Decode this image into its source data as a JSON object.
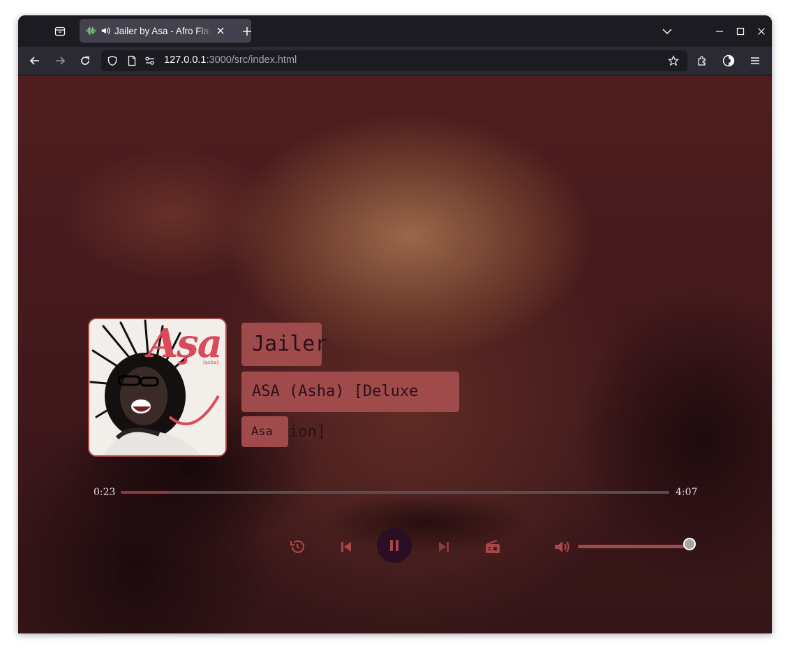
{
  "browser": {
    "tab_title": "Jailer by Asa - Afro Flav",
    "url_host": "127.0.0.1",
    "url_rest": ":3000/src/index.html"
  },
  "player": {
    "song_title": "Jailer",
    "album": "ASA (Asha) [Deluxe Edition]",
    "artist": "Asa",
    "cover_text": "Aşa",
    "cover_subtext": "[asha]",
    "time_elapsed": "0:23",
    "time_total": "4:07",
    "progress_fraction": 0.093,
    "volume_fraction": 1.0,
    "is_playing": true
  },
  "colors": {
    "accent": "#a04b4b",
    "play_button_bg": "#2a0f24",
    "control_icons": "#a8474a"
  },
  "icons": {
    "controls": [
      "history-icon",
      "previous-icon",
      "pause-icon",
      "next-icon",
      "radio-icon",
      "volume-icon"
    ]
  }
}
